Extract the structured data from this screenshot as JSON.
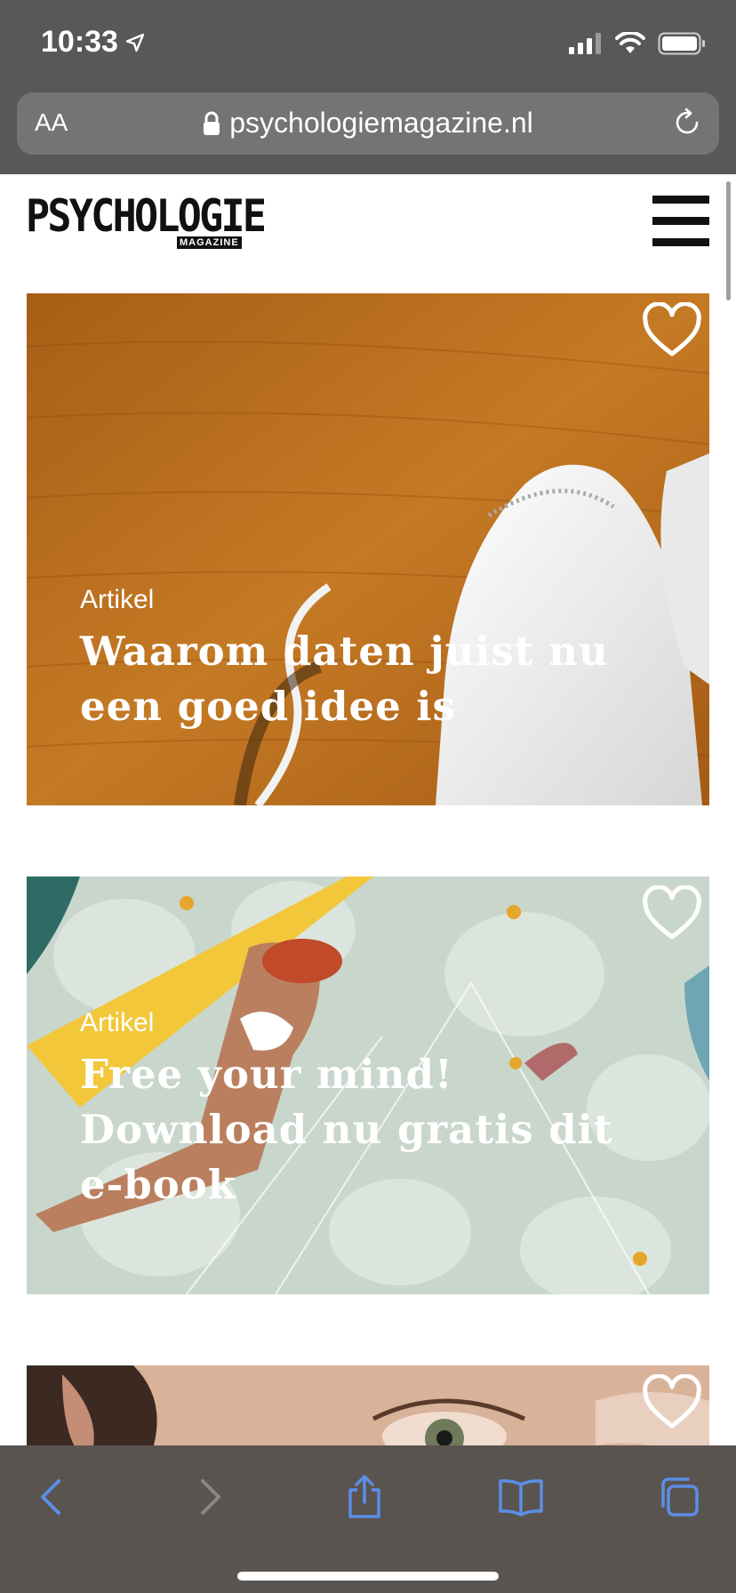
{
  "status": {
    "time": "10:33"
  },
  "browser": {
    "text_size_label": "AA",
    "url": "psychologiemagazine.nl"
  },
  "site": {
    "logo_text": "PSYCHOLOGIE",
    "logo_sub": "MAGAZINE"
  },
  "cards": [
    {
      "category": "Artikel",
      "title": "Waarom daten juist nu een goed idee is"
    },
    {
      "category": "Artikel",
      "title": "Free your mind! Download nu gratis dit e-book"
    },
    {
      "category": "",
      "title": ""
    }
  ],
  "colors": {
    "system_bar": "#585858",
    "url_pill": "#747474",
    "toolbar_bg": "#5a5450",
    "toolbar_icon": "#5b8ee6",
    "toolbar_icon_disabled": "#8c8682"
  },
  "icons": [
    "location-arrow-icon",
    "signal-icon",
    "wifi-icon",
    "battery-icon",
    "lock-icon",
    "reload-icon",
    "menu-icon",
    "heart-icon",
    "back-icon",
    "forward-icon",
    "share-icon",
    "bookmarks-icon",
    "tabs-icon"
  ]
}
